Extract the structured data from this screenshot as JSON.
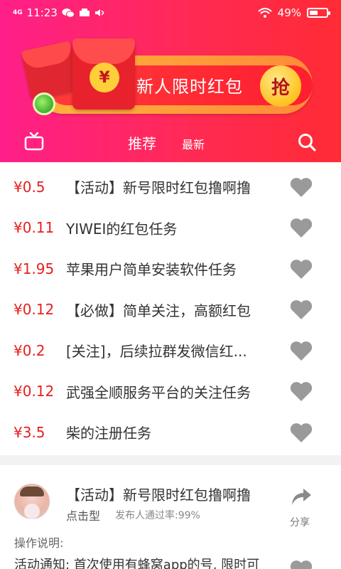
{
  "status_bar": {
    "network": "4G",
    "time": "11:23",
    "battery_percent_text": "49%",
    "battery_level": 0.49
  },
  "banner": {
    "text": "新人限时红包",
    "button_label": "抢",
    "envelope_symbol": "¥"
  },
  "nav": {
    "tab_recommend": "推荐",
    "tab_new": "最新",
    "left_icon": "tv-icon",
    "right_icon": "search-icon"
  },
  "tasks": [
    {
      "price": "¥0.5",
      "title": "【活动】新号限时红包撸啊撸"
    },
    {
      "price": "¥0.11",
      "title": "YIWEI的红包任务"
    },
    {
      "price": "¥1.95",
      "title": "苹果用户简单安装软件任务"
    },
    {
      "price": "¥0.12",
      "title": "【必做】简单关注，高额红包"
    },
    {
      "price": "¥0.2",
      "title": "[关注]，后续拉群发微信红..."
    },
    {
      "price": "¥0.12",
      "title": "武强全顺服务平台的关注任务"
    },
    {
      "price": "¥3.5",
      "title": "柴的注册任务"
    }
  ],
  "detail": {
    "title": "【活动】新号限时红包撸啊撸",
    "type": "点击型",
    "approval_rate": "发布人通过率:99%",
    "share_label": "分享",
    "instructions_label": "操作说明:",
    "instructions_text": "活动通知: 首次使用有蜂窝app的号, 限时可"
  },
  "colors": {
    "header_gradient_start": "#ff1f8a",
    "header_gradient_end": "#ff2b34",
    "price_red": "#e61f1f",
    "heart_gray": "#9a9a9a"
  }
}
